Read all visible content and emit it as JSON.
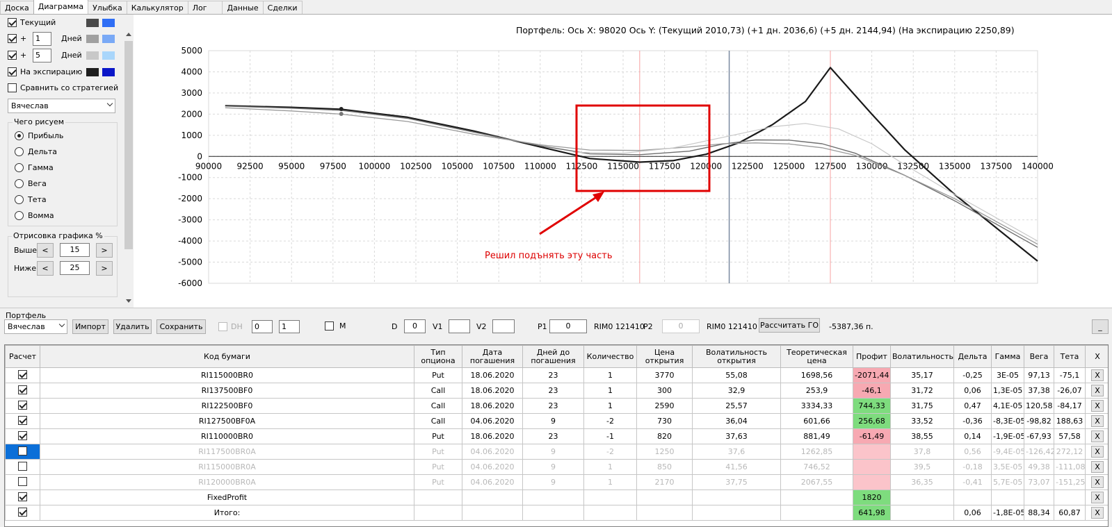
{
  "tabs": [
    "Доска",
    "Диаграмма",
    "Улыбка",
    "Калькулятор",
    "Лог",
    "Данные",
    "Сделки"
  ],
  "left": {
    "current_label": "Текущий",
    "plus1_prefix": "+",
    "plus1_value": "1",
    "plus1_suffix": "Дней",
    "plus2_prefix": "+",
    "plus2_value": "5",
    "plus2_suffix": "Дней",
    "expiry_label": "На экспирацию",
    "compare_label": "Сравнить со стратегией",
    "strategy": "Вячеслав",
    "what_title": "Чего рисуем",
    "radios": [
      "Прибыль",
      "Дельта",
      "Гамма",
      "Вега",
      "Тета",
      "Вомма"
    ],
    "render_title": "Отрисовка графика %",
    "above_label": "Выше",
    "above_value": "15",
    "below_label": "Ниже",
    "below_value": "25",
    "btn_dec": "<",
    "btn_inc": ">"
  },
  "colors": {
    "accent": "#0b6fd8",
    "loss": "#f7a9b2",
    "gain": "#7edc7e",
    "annotation": "#dd0000"
  },
  "chart": {
    "title": "Портфель: Ось X:  98020 Ось Y:   (Текущий 2010,73)   (+1 дн. 2036,6)   (+5 дн. 2144,94)   (На экспирацию 2250,89)",
    "annotation": "Решил подънять эту часть"
  },
  "chart_data": {
    "type": "line",
    "xlim": [
      90000,
      140000
    ],
    "ylim": [
      -6000,
      5000
    ],
    "x_ticks": [
      90000,
      92500,
      95000,
      97500,
      100000,
      102500,
      105000,
      107500,
      110000,
      112500,
      115000,
      117500,
      120000,
      122500,
      125000,
      127500,
      130000,
      132500,
      135000,
      137500,
      140000
    ],
    "y_ticks": [
      5000,
      4000,
      3000,
      2000,
      1000,
      0,
      -1000,
      -2000,
      -3000,
      -4000,
      -5000,
      -6000
    ],
    "grid": true,
    "series": [
      {
        "points": [
          [
            91000,
            2400
          ],
          [
            95000,
            2320
          ],
          [
            98000,
            2230
          ],
          [
            102000,
            1850
          ],
          [
            106000,
            1200
          ],
          [
            110000,
            450
          ],
          [
            113000,
            -100
          ],
          [
            116000,
            -270
          ],
          [
            118000,
            -200
          ],
          [
            120000,
            100
          ],
          [
            122000,
            650
          ],
          [
            124000,
            1500
          ],
          [
            126000,
            2600
          ],
          [
            127500,
            4200
          ],
          [
            130000,
            2000
          ],
          [
            132000,
            300
          ],
          [
            135000,
            -1800
          ],
          [
            140000,
            -4950
          ]
        ]
      },
      {
        "points": [
          [
            91000,
            2380
          ],
          [
            95000,
            2280
          ],
          [
            98000,
            2180
          ],
          [
            102000,
            1800
          ],
          [
            106000,
            1150
          ],
          [
            110000,
            500
          ],
          [
            113000,
            120
          ],
          [
            116000,
            80
          ],
          [
            119000,
            250
          ],
          [
            121000,
            580
          ],
          [
            123000,
            780
          ],
          [
            125000,
            770
          ],
          [
            127000,
            600
          ],
          [
            129000,
            150
          ],
          [
            132000,
            -900
          ],
          [
            135000,
            -2100
          ],
          [
            140000,
            -4300
          ]
        ]
      },
      {
        "points": [
          [
            91000,
            2300
          ],
          [
            95000,
            2150
          ],
          [
            98000,
            2000
          ],
          [
            102000,
            1650
          ],
          [
            106000,
            1050
          ],
          [
            110000,
            550
          ],
          [
            113000,
            300
          ],
          [
            116000,
            280
          ],
          [
            119000,
            450
          ],
          [
            121000,
            600
          ],
          [
            123000,
            640
          ],
          [
            125000,
            590
          ],
          [
            127000,
            410
          ],
          [
            129000,
            50
          ],
          [
            132000,
            -900
          ],
          [
            135000,
            -2000
          ],
          [
            140000,
            -4150
          ]
        ]
      },
      {
        "points": [
          [
            112000,
            200
          ],
          [
            115000,
            150
          ],
          [
            118000,
            400
          ],
          [
            121000,
            900
          ],
          [
            124000,
            1400
          ],
          [
            126000,
            1560
          ],
          [
            128000,
            1300
          ],
          [
            130000,
            600
          ],
          [
            132000,
            -400
          ],
          [
            135000,
            -1800
          ],
          [
            140000,
            -4000
          ]
        ]
      }
    ],
    "markers": [
      [
        98000,
        2240
      ],
      [
        98000,
        2010
      ]
    ],
    "vlines": {
      "red": [
        116000,
        127500
      ],
      "blue": [
        121400
      ]
    }
  },
  "portfolio": {
    "title": "Портфель",
    "strategy": "Вячеслав",
    "import": "Импорт",
    "delete": "Удалить",
    "save": "Сохранить",
    "dh": "DH",
    "dh_v1": "0",
    "dh_v2": "1",
    "m": "M",
    "d_label": "D",
    "d_value": "0",
    "v1": "V1",
    "v2": "V2",
    "p1": "P1",
    "p1_value": "0",
    "rim1": "RIM0 121410",
    "p2": "P2",
    "p2_value": "0",
    "rim2": "RIM0 121410",
    "calc": "Рассчитать ГО",
    "go_value": "-5387,36 п.",
    "min_btn": "_"
  },
  "table": {
    "headers": [
      "Расчет",
      "Код бумаги",
      "Тип опциона",
      "Дата погашения",
      "Дней до погашения",
      "Количество",
      "Цена открытия",
      "Волатильность открытия",
      "Теоретическая цена",
      "Профит",
      "Волатильность",
      "Дельта",
      "Гамма",
      "Вега",
      "Тета",
      "X"
    ],
    "rows": [
      {
        "on": true,
        "code": "RI115000BR0",
        "type": "Put",
        "date": "18.06.2020",
        "days": "23",
        "qty": "1",
        "price": "3770",
        "vol_open": "55,08",
        "theor": "1698,56",
        "profit": "-2071,44",
        "pcls": "loss",
        "vol": "35,17",
        "delta": "-0,25",
        "gamma": "3E-05",
        "vega": "97,13",
        "theta": "-75,1"
      },
      {
        "on": true,
        "code": "RI137500BF0",
        "type": "Call",
        "date": "18.06.2020",
        "days": "23",
        "qty": "1",
        "price": "300",
        "vol_open": "32,9",
        "theor": "253,9",
        "profit": "-46,1",
        "pcls": "loss",
        "vol": "31,72",
        "delta": "0,06",
        "gamma": "1,3E-05",
        "vega": "37,38",
        "theta": "-26,07"
      },
      {
        "on": true,
        "code": "RI122500BF0",
        "type": "Call",
        "date": "18.06.2020",
        "days": "23",
        "qty": "1",
        "price": "2590",
        "vol_open": "25,57",
        "theor": "3334,33",
        "profit": "744,33",
        "pcls": "gain",
        "vol": "31,75",
        "delta": "0,47",
        "gamma": "4,1E-05",
        "vega": "120,58",
        "theta": "-84,17"
      },
      {
        "on": true,
        "code": "RI127500BF0A",
        "type": "Call",
        "date": "04.06.2020",
        "days": "9",
        "qty": "-2",
        "price": "730",
        "vol_open": "36,04",
        "theor": "601,66",
        "profit": "256,68",
        "pcls": "gain",
        "vol": "33,52",
        "delta": "-0,36",
        "gamma": "-8,3E-05",
        "vega": "-98,82",
        "theta": "188,63"
      },
      {
        "on": true,
        "code": "RI110000BR0",
        "type": "Put",
        "date": "18.06.2020",
        "days": "23",
        "qty": "-1",
        "price": "820",
        "vol_open": "37,63",
        "theor": "881,49",
        "profit": "-61,49",
        "pcls": "loss",
        "vol": "38,55",
        "delta": "0,14",
        "gamma": "-1,9E-05",
        "vega": "-67,93",
        "theta": "57,58"
      },
      {
        "on": false,
        "sel": true,
        "code": "RI117500BR0A",
        "type": "Put",
        "date": "04.06.2020",
        "days": "9",
        "qty": "-2",
        "price": "1250",
        "vol_open": "37,6",
        "theor": "1262,85",
        "profit": "",
        "pcls": "loss",
        "vol": "37,8",
        "delta": "0,56",
        "gamma": "-9,4E-05",
        "vega": "-126,42",
        "theta": "272,12"
      },
      {
        "on": false,
        "code": "RI115000BR0A",
        "type": "Put",
        "date": "04.06.2020",
        "days": "9",
        "qty": "1",
        "price": "850",
        "vol_open": "41,56",
        "theor": "746,52",
        "profit": "",
        "pcls": "loss",
        "vol": "39,5",
        "delta": "-0,18",
        "gamma": "3,5E-05",
        "vega": "49,38",
        "theta": "-111,08"
      },
      {
        "on": false,
        "code": "RI120000BR0A",
        "type": "Put",
        "date": "04.06.2020",
        "days": "9",
        "qty": "1",
        "price": "2170",
        "vol_open": "37,75",
        "theor": "2067,55",
        "profit": "",
        "pcls": "loss",
        "vol": "36,35",
        "delta": "-0,41",
        "gamma": "5,7E-05",
        "vega": "73,07",
        "theta": "-151,25"
      },
      {
        "on": true,
        "code": "FixedProfit",
        "type": "",
        "date": "",
        "days": "",
        "qty": "",
        "price": "",
        "vol_open": "",
        "theor": "",
        "profit": "1820",
        "pcls": "gain",
        "vol": "",
        "delta": "",
        "gamma": "",
        "vega": "",
        "theta": ""
      },
      {
        "on": true,
        "code": "Итого:",
        "type": "",
        "date": "",
        "days": "",
        "qty": "",
        "price": "",
        "vol_open": "",
        "theor": "",
        "profit": "641,98",
        "pcls": "gain",
        "vol": "",
        "delta": "0,06",
        "gamma": "-1,8E-05",
        "vega": "88,34",
        "theta": "60,87"
      }
    ],
    "x": "X"
  }
}
